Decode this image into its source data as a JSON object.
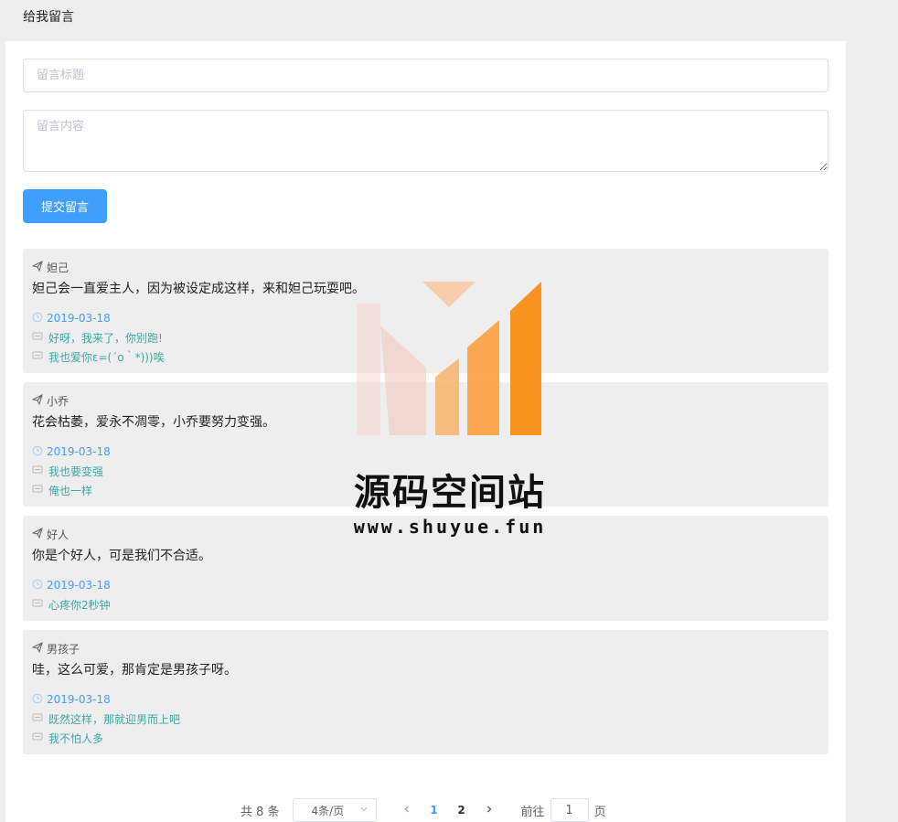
{
  "header": {
    "title": "给我留言"
  },
  "form": {
    "title_placeholder": "留言标题",
    "content_placeholder": "留言内容",
    "submit_label": "提交留言"
  },
  "messages": [
    {
      "author": "妲己",
      "content": "妲己会一直爱主人，因为被设定成这样，来和妲己玩耍吧。",
      "date": "2019-03-18",
      "replies": [
        "好呀，我来了，你别跑!",
        "我也爱你ε=(´ο｀*)))唉"
      ]
    },
    {
      "author": "小乔",
      "content": "花会枯萎，爱永不凋零，小乔要努力变强。",
      "date": "2019-03-18",
      "replies": [
        "我也要变强",
        "俺也一样"
      ]
    },
    {
      "author": "好人",
      "content": "你是个好人，可是我们不合适。",
      "date": "2019-03-18",
      "replies": [
        "心疼你2秒钟"
      ]
    },
    {
      "author": "男孩子",
      "content": "哇，这么可爱，那肯定是男孩子呀。",
      "date": "2019-03-18",
      "replies": [
        "既然这样，那就迎男而上吧",
        "我不怕人多"
      ]
    }
  ],
  "pagination": {
    "total_label": "共 8 条",
    "page_size_label": "4条/页",
    "pages": [
      "1",
      "2"
    ],
    "current_page": "1",
    "goto_label": "前往",
    "jump_value": "1",
    "page_unit": "页"
  },
  "watermark": {
    "title": "源码空间站",
    "url": "www.shuyue.fun"
  },
  "colors": {
    "primary": "#409eff",
    "reply": "#3ca9a0",
    "card_bg": "#eeeeee",
    "watermark_orange": "#f7931e"
  },
  "icons": {
    "author": "paper-plane-icon",
    "date": "clock-icon",
    "reply": "comment-icon",
    "prev": "chevron-left-icon",
    "next": "chevron-right-icon",
    "select": "chevron-down-icon"
  }
}
